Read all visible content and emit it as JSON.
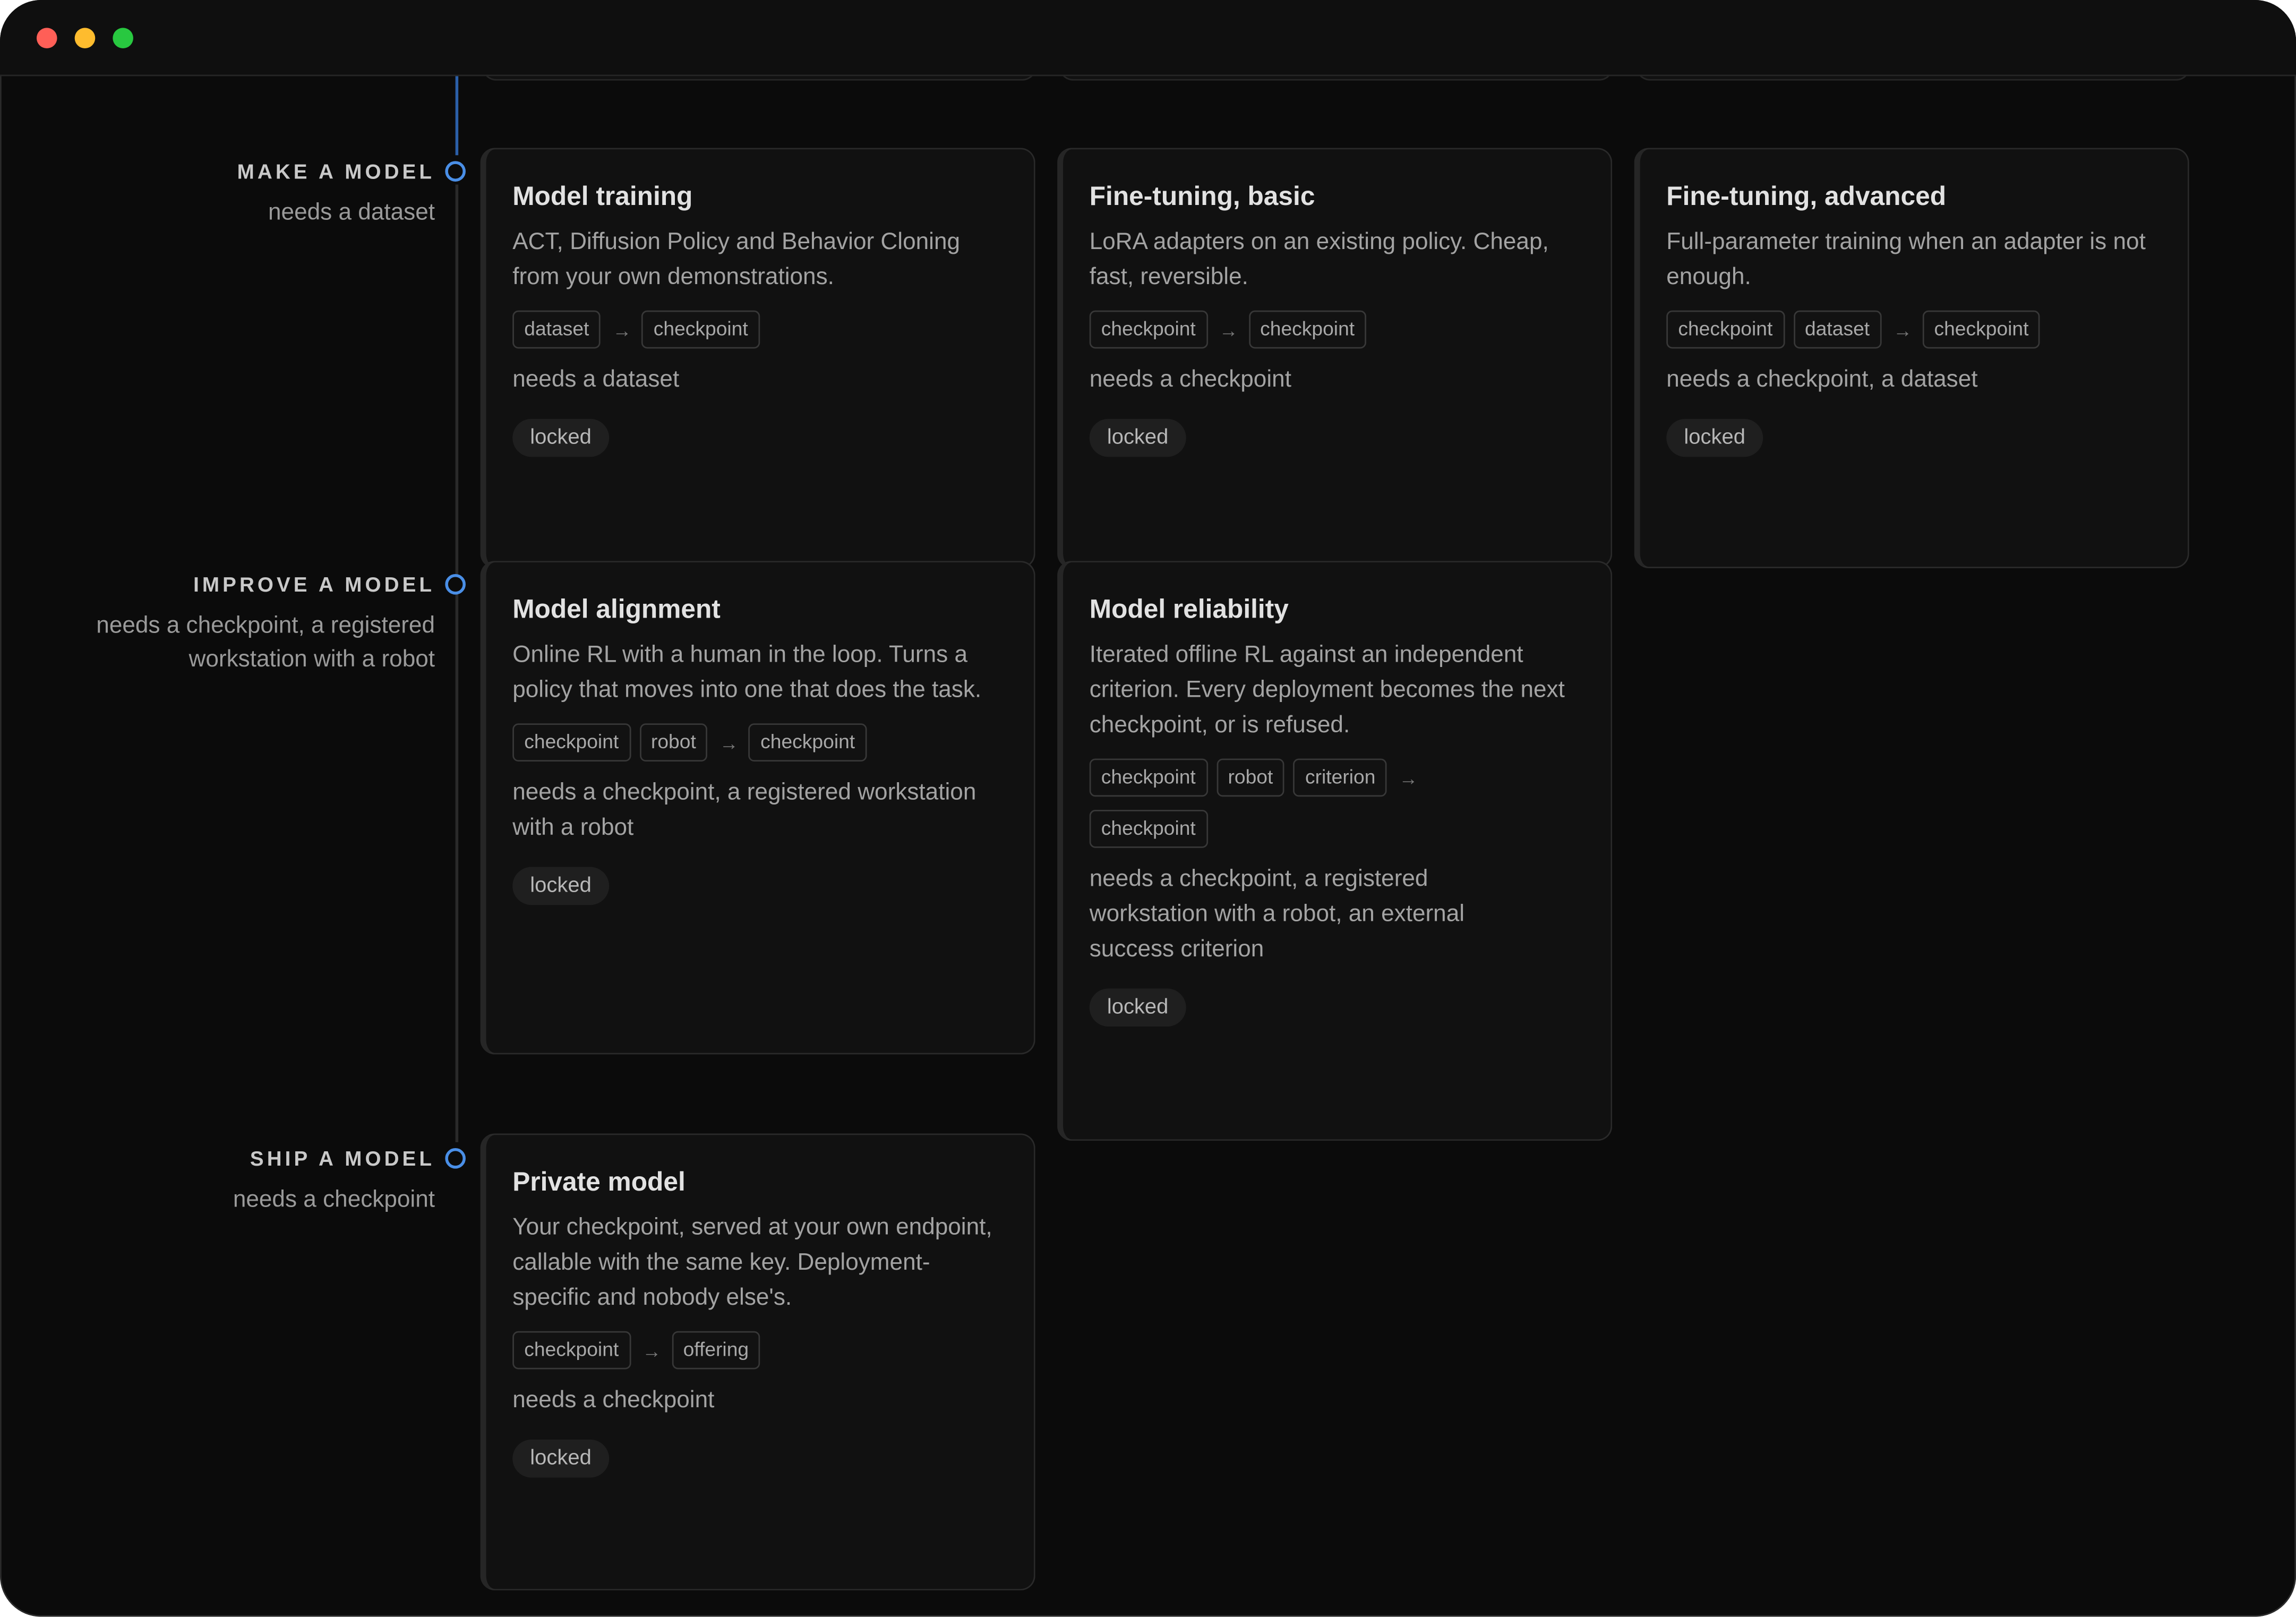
{
  "sections": [
    {
      "title": "MAKE A MODEL",
      "subtitle": "needs a dataset",
      "cards": [
        {
          "title": "Model training",
          "description": "ACT, Diffusion Policy and Behavior Cloning from your own demonstrations.",
          "inputs": [
            "dataset"
          ],
          "outputs": [
            "checkpoint"
          ],
          "needs": "needs a dataset",
          "status": "locked"
        },
        {
          "title": "Fine-tuning, basic",
          "description": "LoRA adapters on an existing policy. Cheap, fast, reversible.",
          "inputs": [
            "checkpoint"
          ],
          "outputs": [
            "checkpoint"
          ],
          "needs": "needs a checkpoint",
          "status": "locked"
        },
        {
          "title": "Fine-tuning, advanced",
          "description": "Full-parameter training when an adapter is not enough.",
          "inputs": [
            "checkpoint",
            "dataset"
          ],
          "outputs": [
            "checkpoint"
          ],
          "needs": "needs a checkpoint, a dataset",
          "status": "locked"
        }
      ]
    },
    {
      "title": "IMPROVE A MODEL",
      "subtitle": "needs a checkpoint, a registered workstation with a robot",
      "cards": [
        {
          "title": "Model alignment",
          "description": "Online RL with a human in the loop. Turns a policy that moves into one that does the task.",
          "inputs": [
            "checkpoint",
            "robot"
          ],
          "outputs": [
            "checkpoint"
          ],
          "needs": "needs a checkpoint, a registered workstation with a robot",
          "status": "locked"
        },
        {
          "title": "Model reliability",
          "description": "Iterated offline RL against an independent criterion. Every deployment becomes the next checkpoint, or is refused.",
          "inputs": [
            "checkpoint",
            "robot",
            "criterion"
          ],
          "outputs": [
            "checkpoint"
          ],
          "needs": "needs a checkpoint, a registered workstation with a robot, an external success criterion",
          "status": "locked"
        }
      ]
    },
    {
      "title": "SHIP A MODEL",
      "subtitle": "needs a checkpoint",
      "cards": [
        {
          "title": "Private model",
          "description": "Your checkpoint, served at your own endpoint, callable with the same key. Deployment-specific and nobody else's.",
          "inputs": [
            "checkpoint"
          ],
          "outputs": [
            "offering"
          ],
          "needs": "needs a checkpoint",
          "status": "locked"
        }
      ]
    }
  ],
  "icons": {
    "flow_arrow": "→",
    "section_node": "ring-icon"
  },
  "colors": {
    "background": "#0b0b0b",
    "card": "#111111",
    "accent": "#4a8fe7",
    "window_close": "#ff5f57",
    "window_minimize": "#febc2e",
    "window_zoom": "#28c840"
  }
}
